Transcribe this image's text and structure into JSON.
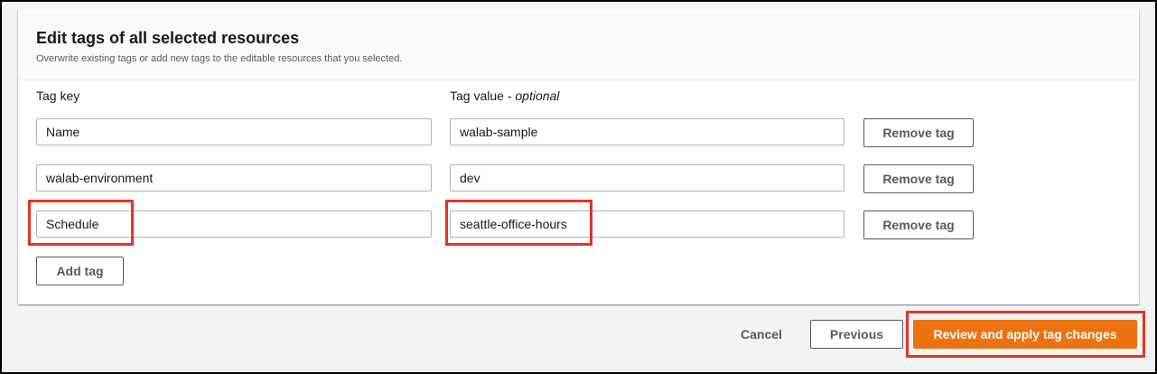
{
  "panel": {
    "title": "Edit tags of all selected resources",
    "description": "Overwrite existing tags or add new tags to the editable resources that you selected."
  },
  "columns": {
    "key_label": "Tag key",
    "value_label": "Tag value - ",
    "value_optional": "optional"
  },
  "tags": [
    {
      "key": "Name",
      "value": "walab-sample",
      "remove_label": "Remove tag"
    },
    {
      "key": "walab-environment",
      "value": "dev",
      "remove_label": "Remove tag"
    },
    {
      "key": "Schedule",
      "value": "seattle-office-hours",
      "remove_label": "Remove tag"
    }
  ],
  "add_tag_label": "Add tag",
  "footer": {
    "cancel_label": "Cancel",
    "previous_label": "Previous",
    "submit_label": "Review and apply tag changes"
  },
  "colors": {
    "primary": "#ec7211",
    "highlight": "#e8331c"
  }
}
